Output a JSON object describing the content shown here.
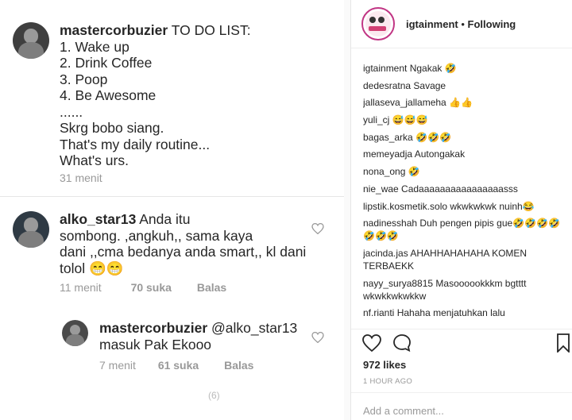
{
  "left": {
    "comments": [
      {
        "username": "mastercorbuzier",
        "lines": [
          "TO DO LIST:",
          "1. Wake up",
          "2. Drink Coffee",
          "3. Poop",
          "4. Be Awesome",
          "......",
          "Skrg bobo siang.",
          "That's my daily routine...",
          "What's urs."
        ],
        "time": "31 menit"
      },
      {
        "username": "alko_star13",
        "lines": [
          "Anda itu",
          "sombong. ,angkuh,, sama kaya",
          "dani ,,cma bedanya anda smart,, kl dani",
          "tolol 😁😁"
        ],
        "time": "11 menit",
        "likes": "70 suka",
        "reply": "Balas"
      },
      {
        "username": "mastercorbuzier",
        "lines": [
          "@alko_star13",
          "masuk Pak Ekooo"
        ],
        "time": "7 menit",
        "likes": "61 suka",
        "reply": "Balas"
      }
    ],
    "partial_text": "(6)"
  },
  "right": {
    "header": {
      "username": "igtainment",
      "separator": "•",
      "follow_status": "Following"
    },
    "comments": [
      {
        "user": "igtainment",
        "text": "Ngakak 🤣"
      },
      {
        "user": "dedesratna",
        "text": "Savage"
      },
      {
        "user": "jallaseva_jallameha",
        "text": "👍👍"
      },
      {
        "user": "yuli_cj",
        "text": "😅😅😅"
      },
      {
        "user": "bagas_arka",
        "text": "🤣🤣🤣"
      },
      {
        "user": "memeyadja",
        "text": "Autongakak"
      },
      {
        "user": "nona_ong",
        "text": "🤣"
      },
      {
        "user": "nie_wae",
        "text": "Cadaaaaaaaaaaaaaaaasss"
      },
      {
        "user": "lipstik.kosmetik.solo",
        "text": "wkwkwkwk nuinh😂"
      },
      {
        "user": "nadinesshah",
        "text": "Duh pengen pipis gue🤣🤣🤣🤣🤣🤣🤣"
      },
      {
        "user": "jacinda.jas",
        "text": "AHAHHAHAHAHA KOMEN TERBAEKK"
      },
      {
        "user": "nayy_surya8815",
        "text": "Masoooookkkm bgtttt wkwkkwkwkkw"
      },
      {
        "user": "nf.rianti",
        "text": "Hahaha menjatuhkan lalu"
      }
    ],
    "likes": "972 likes",
    "time_ago": "1 HOUR AGO",
    "add_comment_placeholder": "Add a comment..."
  }
}
